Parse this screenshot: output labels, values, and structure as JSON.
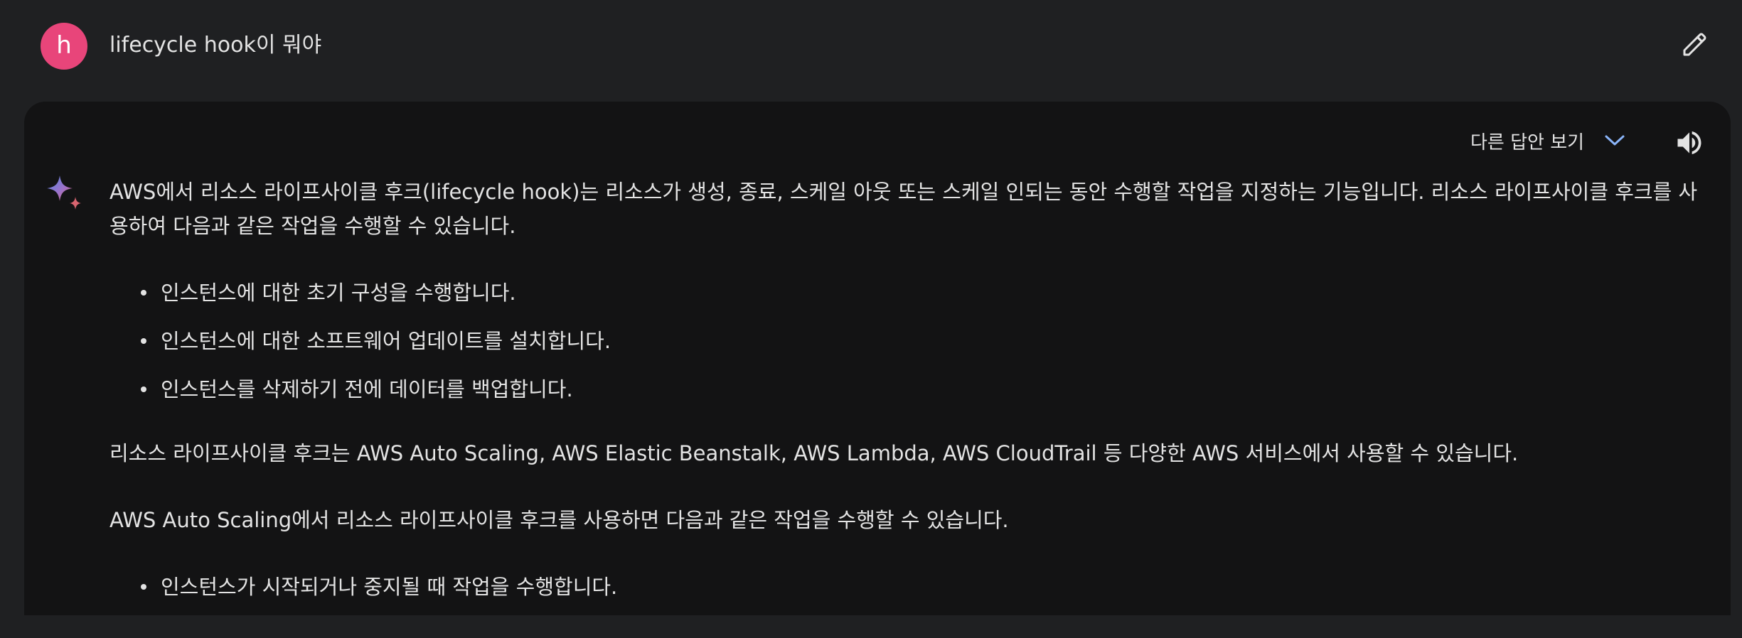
{
  "prompt": {
    "avatar_letter": "h",
    "text": "lifecycle hook이 뭐야"
  },
  "toolbar": {
    "edit_icon": "pencil-icon",
    "drafts_label": "다른 답안 보기",
    "drafts_icon": "chevron-down-icon",
    "speaker_icon": "volume-icon"
  },
  "response": {
    "intro": "AWS에서 리소스 라이프사이클 후크(lifecycle hook)는 리소스가 생성, 종료, 스케일 아웃 또는 스케일 인되는 동안 수행할 작업을 지정하는 기능입니다. 리소스 라이프사이클 후크를 사용하여 다음과 같은 작업을 수행할 수 있습니다.",
    "list1": [
      "인스턴스에 대한 초기 구성을 수행합니다.",
      "인스턴스에 대한 소프트웨어 업데이트를 설치합니다.",
      "인스턴스를 삭제하기 전에 데이터를 백업합니다."
    ],
    "services": "리소스 라이프사이클 후크는 AWS Auto Scaling, AWS Elastic Beanstalk, AWS Lambda, AWS CloudTrail 등 다양한 AWS 서비스에서 사용할 수 있습니다.",
    "autoscaling": "AWS Auto Scaling에서 리소스 라이프사이클 후크를 사용하면 다음과 같은 작업을 수행할 수 있습니다.",
    "list2": [
      "인스턴스가 시작되거나 중지될 때 작업을 수행합니다."
    ]
  },
  "colors": {
    "background": "#1f2022",
    "card": "#131314",
    "avatar": "#e8457a",
    "accent": "#8ab4f8"
  }
}
